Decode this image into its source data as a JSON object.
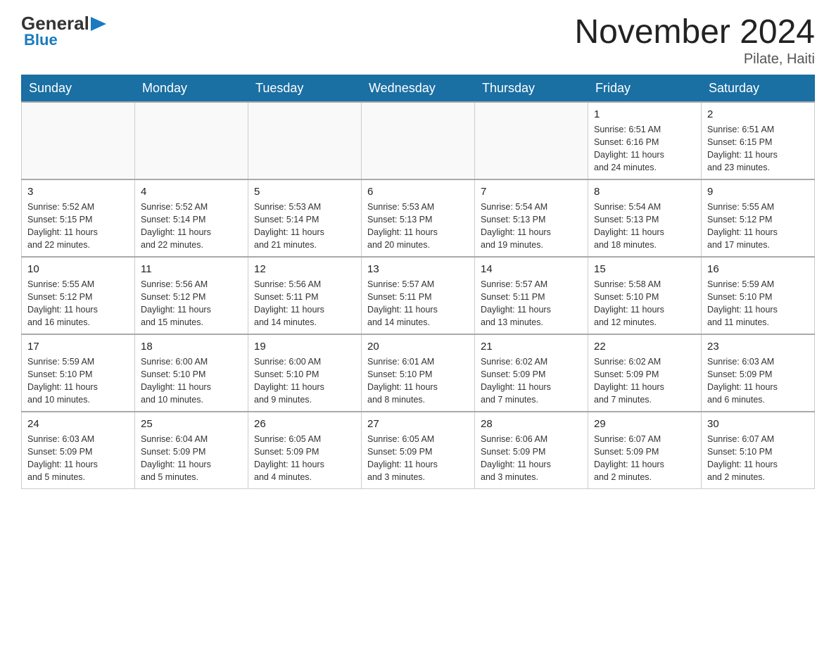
{
  "header": {
    "logo_general": "General",
    "logo_blue": "Blue",
    "month_title": "November 2024",
    "location": "Pilate, Haiti"
  },
  "days_of_week": [
    "Sunday",
    "Monday",
    "Tuesday",
    "Wednesday",
    "Thursday",
    "Friday",
    "Saturday"
  ],
  "weeks": [
    [
      {
        "day": "",
        "info": ""
      },
      {
        "day": "",
        "info": ""
      },
      {
        "day": "",
        "info": ""
      },
      {
        "day": "",
        "info": ""
      },
      {
        "day": "",
        "info": ""
      },
      {
        "day": "1",
        "info": "Sunrise: 6:51 AM\nSunset: 6:16 PM\nDaylight: 11 hours\nand 24 minutes."
      },
      {
        "day": "2",
        "info": "Sunrise: 6:51 AM\nSunset: 6:15 PM\nDaylight: 11 hours\nand 23 minutes."
      }
    ],
    [
      {
        "day": "3",
        "info": "Sunrise: 5:52 AM\nSunset: 5:15 PM\nDaylight: 11 hours\nand 22 minutes."
      },
      {
        "day": "4",
        "info": "Sunrise: 5:52 AM\nSunset: 5:14 PM\nDaylight: 11 hours\nand 22 minutes."
      },
      {
        "day": "5",
        "info": "Sunrise: 5:53 AM\nSunset: 5:14 PM\nDaylight: 11 hours\nand 21 minutes."
      },
      {
        "day": "6",
        "info": "Sunrise: 5:53 AM\nSunset: 5:13 PM\nDaylight: 11 hours\nand 20 minutes."
      },
      {
        "day": "7",
        "info": "Sunrise: 5:54 AM\nSunset: 5:13 PM\nDaylight: 11 hours\nand 19 minutes."
      },
      {
        "day": "8",
        "info": "Sunrise: 5:54 AM\nSunset: 5:13 PM\nDaylight: 11 hours\nand 18 minutes."
      },
      {
        "day": "9",
        "info": "Sunrise: 5:55 AM\nSunset: 5:12 PM\nDaylight: 11 hours\nand 17 minutes."
      }
    ],
    [
      {
        "day": "10",
        "info": "Sunrise: 5:55 AM\nSunset: 5:12 PM\nDaylight: 11 hours\nand 16 minutes."
      },
      {
        "day": "11",
        "info": "Sunrise: 5:56 AM\nSunset: 5:12 PM\nDaylight: 11 hours\nand 15 minutes."
      },
      {
        "day": "12",
        "info": "Sunrise: 5:56 AM\nSunset: 5:11 PM\nDaylight: 11 hours\nand 14 minutes."
      },
      {
        "day": "13",
        "info": "Sunrise: 5:57 AM\nSunset: 5:11 PM\nDaylight: 11 hours\nand 14 minutes."
      },
      {
        "day": "14",
        "info": "Sunrise: 5:57 AM\nSunset: 5:11 PM\nDaylight: 11 hours\nand 13 minutes."
      },
      {
        "day": "15",
        "info": "Sunrise: 5:58 AM\nSunset: 5:10 PM\nDaylight: 11 hours\nand 12 minutes."
      },
      {
        "day": "16",
        "info": "Sunrise: 5:59 AM\nSunset: 5:10 PM\nDaylight: 11 hours\nand 11 minutes."
      }
    ],
    [
      {
        "day": "17",
        "info": "Sunrise: 5:59 AM\nSunset: 5:10 PM\nDaylight: 11 hours\nand 10 minutes."
      },
      {
        "day": "18",
        "info": "Sunrise: 6:00 AM\nSunset: 5:10 PM\nDaylight: 11 hours\nand 10 minutes."
      },
      {
        "day": "19",
        "info": "Sunrise: 6:00 AM\nSunset: 5:10 PM\nDaylight: 11 hours\nand 9 minutes."
      },
      {
        "day": "20",
        "info": "Sunrise: 6:01 AM\nSunset: 5:10 PM\nDaylight: 11 hours\nand 8 minutes."
      },
      {
        "day": "21",
        "info": "Sunrise: 6:02 AM\nSunset: 5:09 PM\nDaylight: 11 hours\nand 7 minutes."
      },
      {
        "day": "22",
        "info": "Sunrise: 6:02 AM\nSunset: 5:09 PM\nDaylight: 11 hours\nand 7 minutes."
      },
      {
        "day": "23",
        "info": "Sunrise: 6:03 AM\nSunset: 5:09 PM\nDaylight: 11 hours\nand 6 minutes."
      }
    ],
    [
      {
        "day": "24",
        "info": "Sunrise: 6:03 AM\nSunset: 5:09 PM\nDaylight: 11 hours\nand 5 minutes."
      },
      {
        "day": "25",
        "info": "Sunrise: 6:04 AM\nSunset: 5:09 PM\nDaylight: 11 hours\nand 5 minutes."
      },
      {
        "day": "26",
        "info": "Sunrise: 6:05 AM\nSunset: 5:09 PM\nDaylight: 11 hours\nand 4 minutes."
      },
      {
        "day": "27",
        "info": "Sunrise: 6:05 AM\nSunset: 5:09 PM\nDaylight: 11 hours\nand 3 minutes."
      },
      {
        "day": "28",
        "info": "Sunrise: 6:06 AM\nSunset: 5:09 PM\nDaylight: 11 hours\nand 3 minutes."
      },
      {
        "day": "29",
        "info": "Sunrise: 6:07 AM\nSunset: 5:09 PM\nDaylight: 11 hours\nand 2 minutes."
      },
      {
        "day": "30",
        "info": "Sunrise: 6:07 AM\nSunset: 5:10 PM\nDaylight: 11 hours\nand 2 minutes."
      }
    ]
  ]
}
